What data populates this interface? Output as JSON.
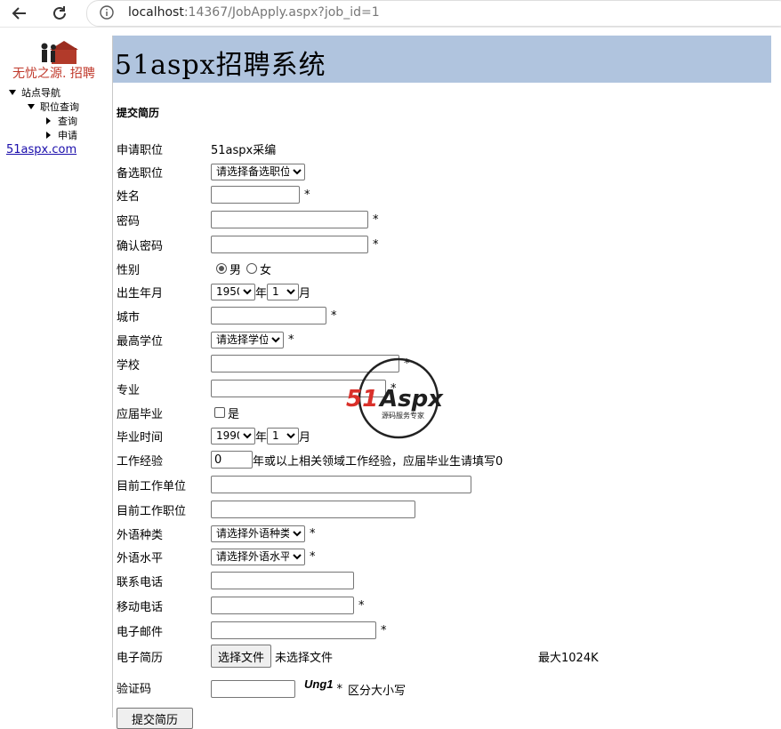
{
  "browser": {
    "url_host": "localhost",
    "url_rest": ":14367/JobApply.aspx?job_id=1"
  },
  "sidebar": {
    "logo_text": "无忧之源. 招聘",
    "tree": {
      "root": "站点导航",
      "group": "职位查询",
      "items": [
        "查询",
        "申请"
      ]
    },
    "link": "51aspx.com"
  },
  "header": {
    "title": "51aspx招聘系统"
  },
  "form": {
    "section_title": "提交简历",
    "position_label": "申请职位",
    "position_value": "51aspx采编",
    "alt_position_label": "备选职位",
    "alt_position_value": "请选择备选职位",
    "name_label": "姓名",
    "password_label": "密码",
    "confirm_label": "确认密码",
    "gender_label": "性别",
    "gender_male": "男",
    "gender_female": "女",
    "gender_selected": "男",
    "birth_label": "出生年月",
    "birth_year": "1950",
    "birth_year_unit": "年",
    "birth_month": "1",
    "birth_month_unit": "月",
    "city_label": "城市",
    "degree_label": "最高学位",
    "degree_value": "请选择学位",
    "school_label": "学校",
    "major_label": "专业",
    "fresh_label": "应届毕业",
    "fresh_check_text": "是",
    "grad_label": "毕业时间",
    "grad_year": "1990",
    "grad_year_unit": "年",
    "grad_month": "1",
    "grad_month_unit": "月",
    "exp_label": "工作经验",
    "exp_value": "0",
    "exp_note": "年或以上相关领域工作经验，应届毕业生请填写0",
    "company_label": "目前工作单位",
    "job_title_label": "目前工作职位",
    "lang_label": "外语种类",
    "lang_value": "请选择外语种类",
    "lang_level_label": "外语水平",
    "lang_level_value": "请选择外语水平",
    "phone_label": "联系电话",
    "mobile_label": "移动电话",
    "email_label": "电子邮件",
    "resume_label": "电子简历",
    "file_button": "选择文件",
    "file_status": "未选择文件",
    "file_limit": "最大1024K",
    "captcha_label": "验证码",
    "captcha_code": "Ung1",
    "captcha_note": "区分大小写",
    "required_mark": "*",
    "submit_label": "提交简历"
  },
  "watermark": {
    "brand": "51Aspx",
    "tagline": "源码服务专家"
  }
}
